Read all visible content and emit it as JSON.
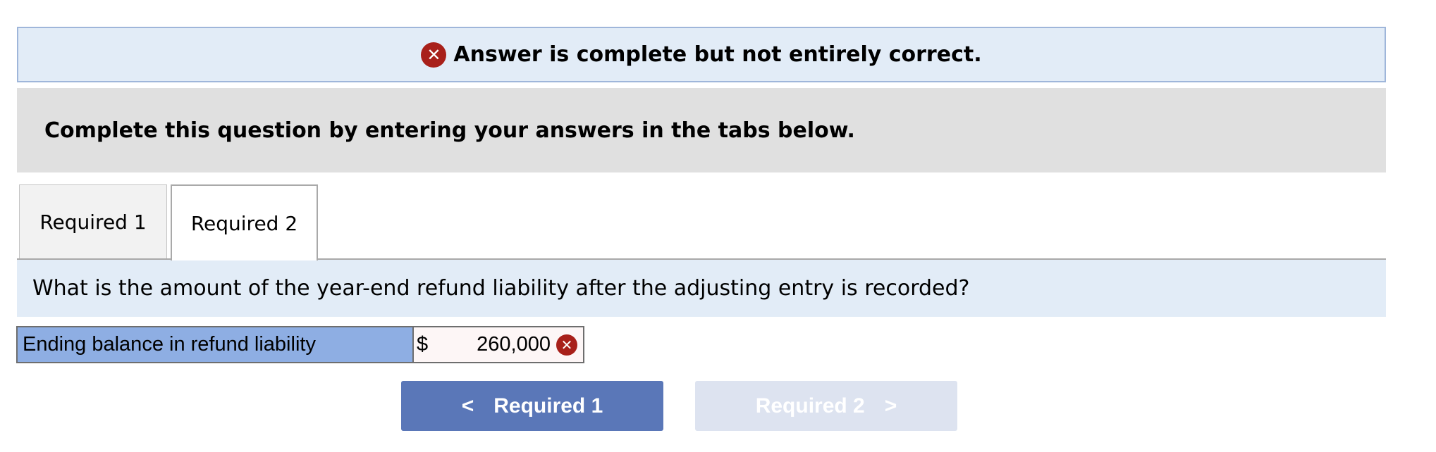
{
  "banner": {
    "icon": "error-x-icon",
    "text": "Answer is complete but not entirely correct.",
    "icon_color": "#a8201a"
  },
  "instructions": "Complete this question by entering your answers in the tabs below.",
  "tabs": [
    {
      "label": "Required 1",
      "active": false
    },
    {
      "label": "Required 2",
      "active": true
    }
  ],
  "question": "What is the amount of the year-end refund liability after the adjusting entry is recorded?",
  "answer_row": {
    "label": "Ending balance in refund liability",
    "currency": "$",
    "value": "260,000",
    "status_icon": "error-x-icon",
    "label_bg": "#8eaee3"
  },
  "nav": {
    "prev_label": "Required 1",
    "next_label": "Required 2",
    "prev_color": "#5a77b8",
    "next_color": "#dde3f0",
    "next_disabled": true
  }
}
